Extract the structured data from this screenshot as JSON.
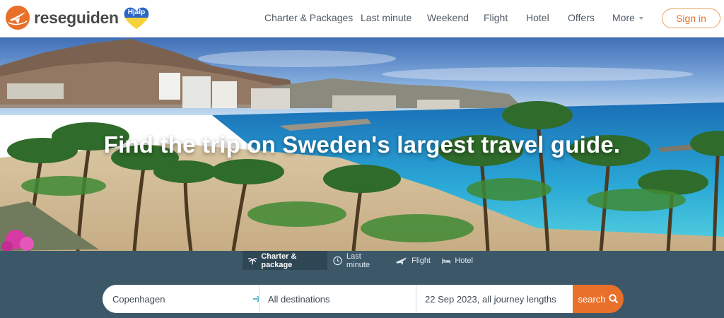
{
  "header": {
    "logo_text": "reseguiden",
    "help_label": "Hjälp",
    "nav": [
      {
        "label": "Charter & Packages"
      },
      {
        "label": "Last minute"
      },
      {
        "label": "Weekend"
      },
      {
        "label": "Flight"
      },
      {
        "label": "Hotel"
      },
      {
        "label": "Offers"
      },
      {
        "label": "More"
      }
    ],
    "signin_label": "Sign in"
  },
  "hero": {
    "title": "Find the trip on Sweden's largest travel guide."
  },
  "search": {
    "tabs": [
      {
        "label": "Charter & package",
        "icon": "palm-icon",
        "active": true
      },
      {
        "label": "Last minute",
        "icon": "clock-icon",
        "active": false
      },
      {
        "label": "Flight",
        "icon": "plane-icon",
        "active": false
      },
      {
        "label": "Hotel",
        "icon": "bed-icon",
        "active": false
      }
    ],
    "from_value": "Copenhagen",
    "to_value": "All destinations",
    "date_value": "22 Sep 2023, all journey lengths",
    "search_label": "search"
  },
  "colors": {
    "accent": "#e8702a",
    "band": "#3c5868",
    "active_tab": "#2f4654",
    "text": "#4f5b66"
  }
}
